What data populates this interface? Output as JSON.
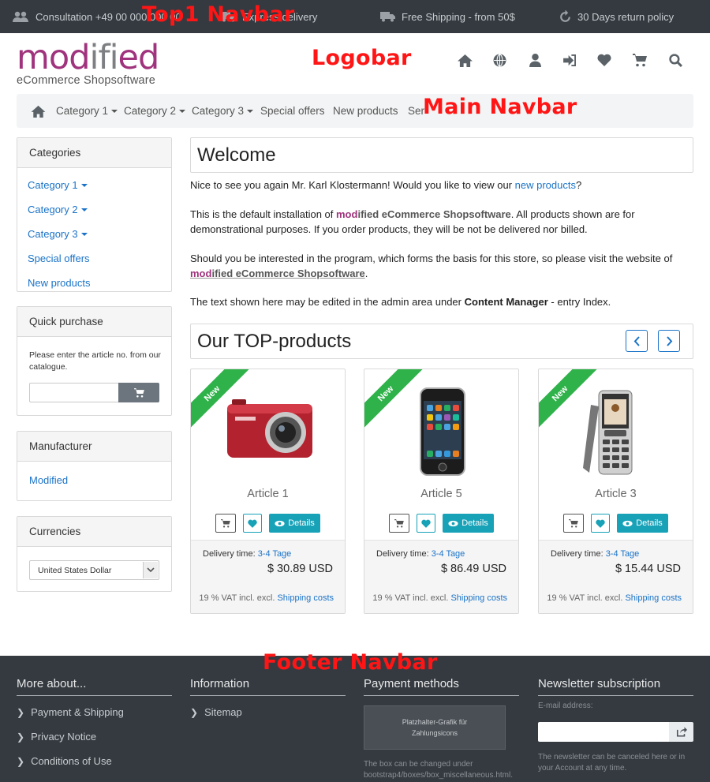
{
  "topbar": {
    "items": [
      {
        "icon": "users-icon",
        "text": "Consultation +49 00 000 000 00"
      },
      {
        "icon": "truck-icon",
        "text": "Express delivery"
      },
      {
        "icon": "truck-icon",
        "text": "Free Shipping - from 50$"
      },
      {
        "icon": "return-icon",
        "text": "30 Days return policy"
      }
    ]
  },
  "annotations": {
    "top1": "Top1 Navbar",
    "logobar": "Logobar",
    "mainnav": "Main Navbar",
    "footer": "Footer Navbar"
  },
  "logo": {
    "word_part1": "mod",
    "word_part2": "ifi",
    "word_part3": "ed",
    "tagline": "eCommerce Shopsoftware"
  },
  "logo_icons": [
    "home-icon",
    "globe-icon",
    "user-icon",
    "login-icon",
    "heart-icon",
    "cart-icon",
    "search-icon"
  ],
  "main_nav": {
    "items": [
      "Category 1",
      "Category 2",
      "Category 3",
      "Special offers",
      "New products",
      "Ser"
    ]
  },
  "sidebar": {
    "categories": {
      "title": "Categories",
      "items": [
        "Category 1",
        "Category 2",
        "Category 3",
        "Special offers",
        "New products"
      ]
    },
    "quick_purchase": {
      "title": "Quick purchase",
      "text": "Please enter the article no. from our catalogue."
    },
    "manufacturer": {
      "title": "Manufacturer",
      "link": "Modified"
    },
    "currencies": {
      "title": "Currencies",
      "selected": "United States Dollar"
    }
  },
  "main": {
    "welcome_title": "Welcome",
    "p1_pre": "Nice to see you again Mr. Karl Klostermann! Would you like to view our ",
    "p1_link": "new products",
    "p1_post": "?",
    "p2_pre": "This is the default installation of ",
    "p2_mod": "mod",
    "p2_brand": "ified eCommerce Shopsoftware",
    "p2_post": ". All products shown are for demonstrational purposes. If you order products, they will be not be delivered nor billed.",
    "p3_pre": "Should you be interested in the program, which forms the basis for this store, so please visit the website of ",
    "p3_mod": "mod",
    "p3_brand": "ified eCommerce Shopsoftware",
    "p3_post": ".",
    "p4_pre": "The text shown here may be edited in the admin area under ",
    "p4_bold": "Content Manager",
    "p4_post": " - entry Index.",
    "top_title": "Our TOP-products",
    "products": [
      {
        "badge": "New",
        "name": "Article 1",
        "details": "Details",
        "delivery_label": "Delivery time: ",
        "delivery_value": "3-4 Tage",
        "price": "$ 30.89 USD",
        "vat": "19 % VAT incl. excl. ",
        "shipping": "Shipping costs"
      },
      {
        "badge": "New",
        "name": "Article 5",
        "details": "Details",
        "delivery_label": "Delivery time: ",
        "delivery_value": "3-4 Tage",
        "price": "$ 86.49 USD",
        "vat": "19 % VAT incl. excl. ",
        "shipping": "Shipping costs"
      },
      {
        "badge": "New",
        "name": "Article 3",
        "details": "Details",
        "delivery_label": "Delivery time: ",
        "delivery_value": "3-4 Tage",
        "price": "$ 15.44 USD",
        "vat": "19 % VAT incl. excl. ",
        "shipping": "Shipping costs"
      }
    ]
  },
  "footer": {
    "col1": {
      "title": "More about...",
      "links": [
        "Payment & Shipping",
        "Privacy Notice",
        "Conditions of Use"
      ]
    },
    "col2": {
      "title": "Information",
      "links": [
        "Sitemap"
      ]
    },
    "col3": {
      "title": "Payment methods",
      "placeholder": "Platzhalter-Grafik für Zahlungsicons",
      "note": "The box can be changed under bootstrap4/boxes/box_miscellaneous.html."
    },
    "col4": {
      "title": "Newsletter subscription",
      "label": "E-mail address:",
      "note": "The newsletter can be canceled here or in your Account at any time."
    }
  },
  "colors": {
    "accent": "#17a2b8",
    "brand": "#a0337d",
    "link": "#1a73c8",
    "dark": "#343a40",
    "ribbon": "#2fb24a"
  }
}
